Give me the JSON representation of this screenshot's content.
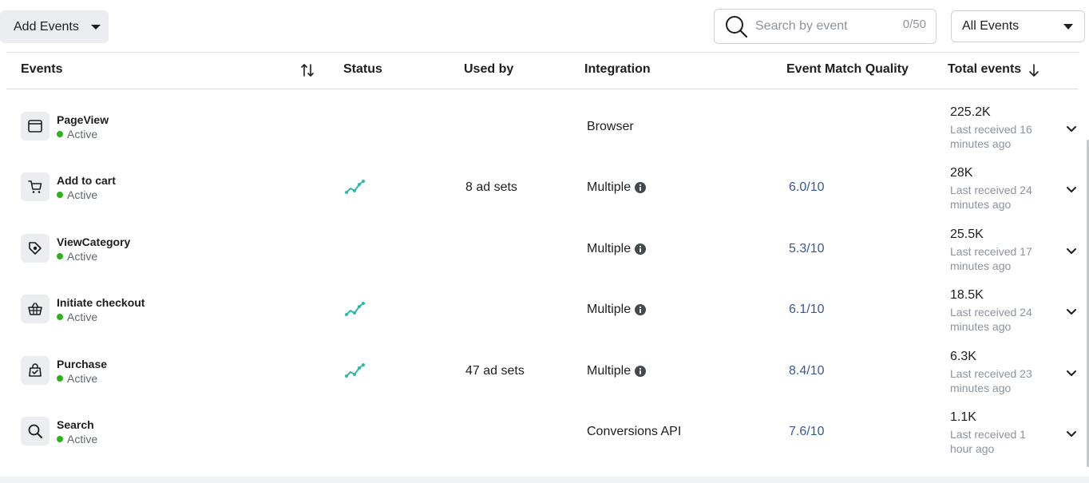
{
  "toolbar": {
    "add_events_label": "Add Events",
    "search_placeholder": "Search by event",
    "search_count": "0/50",
    "filter_value": "All Events"
  },
  "columns": {
    "events": "Events",
    "status": "Status",
    "used_by": "Used by",
    "integration": "Integration",
    "emq": "Event Match Quality",
    "total": "Total events"
  },
  "rows": [
    {
      "name": "PageView",
      "status": "Active",
      "icon": "browser-window-icon",
      "has_graph": false,
      "used_by": "",
      "integration": "Browser",
      "has_info": false,
      "emq": "",
      "total": "225.2K",
      "last_received": "Last received 16 minutes ago"
    },
    {
      "name": "Add to cart",
      "status": "Active",
      "icon": "shopping-cart-icon",
      "has_graph": true,
      "used_by": "8 ad sets",
      "integration": "Multiple",
      "has_info": true,
      "emq": "6.0/10",
      "total": "28K",
      "last_received": "Last received 24 minutes ago"
    },
    {
      "name": "ViewCategory",
      "status": "Active",
      "icon": "tag-icon",
      "has_graph": false,
      "used_by": "",
      "integration": "Multiple",
      "has_info": true,
      "emq": "5.3/10",
      "total": "25.5K",
      "last_received": "Last received 17 minutes ago"
    },
    {
      "name": "Initiate checkout",
      "status": "Active",
      "icon": "basket-icon",
      "has_graph": true,
      "used_by": "",
      "integration": "Multiple",
      "has_info": true,
      "emq": "6.1/10",
      "total": "18.5K",
      "last_received": "Last received 24 minutes ago"
    },
    {
      "name": "Purchase",
      "status": "Active",
      "icon": "shopping-bag-icon",
      "has_graph": true,
      "used_by": "47 ad sets",
      "integration": "Multiple",
      "has_info": true,
      "emq": "8.4/10",
      "total": "6.3K",
      "last_received": "Last received 23 minutes ago"
    },
    {
      "name": "Search",
      "status": "Active",
      "icon": "search-icon",
      "has_graph": false,
      "used_by": "",
      "integration": "Conversions API",
      "has_info": false,
      "emq": "7.6/10",
      "total": "1.1K",
      "last_received": "Last received 1 hour ago"
    }
  ],
  "colors": {
    "active_dot": "#2bb317",
    "emq_link": "#385898",
    "graph": "#2abba7"
  }
}
